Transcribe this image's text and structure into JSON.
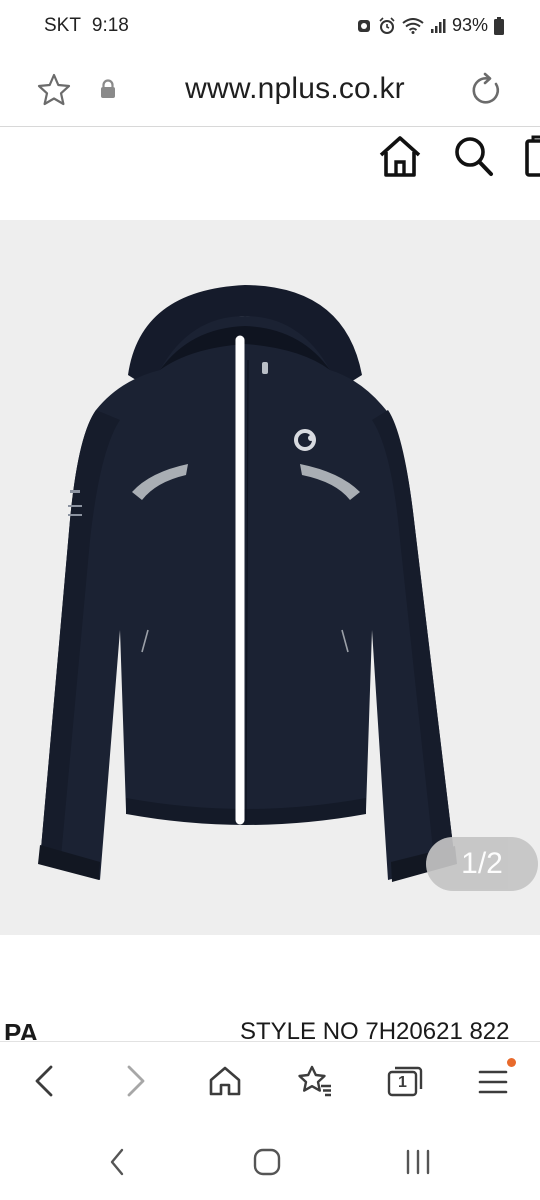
{
  "status_bar": {
    "carrier": "SKT",
    "time": "9:18",
    "battery": "93%"
  },
  "browser": {
    "url": "www.nplus.co.kr",
    "icons": [
      "star-icon",
      "lock-icon",
      "reload-icon"
    ]
  },
  "site_header": {
    "icons": [
      "home-icon",
      "search-icon",
      "cart-icon"
    ]
  },
  "product": {
    "image_counter": "1/2",
    "brand_partial": "PA",
    "style_no": "STYLE NO 7H20621 822"
  },
  "bottom_nav": {
    "items": [
      "back-icon",
      "forward-icon",
      "home-icon",
      "bookmarks-icon",
      "tabs-icon",
      "menu-icon"
    ],
    "tab_count": "1",
    "menu_notification_color": "#e86a2c"
  },
  "system_nav": {
    "items": [
      "back-icon",
      "home-icon",
      "recents-icon"
    ]
  },
  "colors": {
    "jacket": "#1b2233",
    "image_bg": "#eeeeee",
    "zipper": "#ffffff",
    "reflective": "#a9aeb4"
  }
}
